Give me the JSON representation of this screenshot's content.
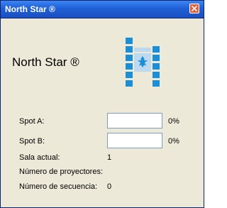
{
  "window": {
    "title": "North Star ®"
  },
  "app": {
    "name": "North Star ®",
    "logo_icon": "film-strip-with-star-icon",
    "logo_color": "#1a8fd8"
  },
  "spots": [
    {
      "label": "Spot A:",
      "value": "",
      "percent": "0%"
    },
    {
      "label": "Spot B:",
      "value": "",
      "percent": "0%"
    }
  ],
  "info": {
    "sala_label": "Sala actual:",
    "sala_value": "1",
    "proyectores_label": "Número de proyectores:",
    "proyectores_value": "",
    "secuencia_label": "Número de secuencia:",
    "secuencia_value": "0"
  }
}
